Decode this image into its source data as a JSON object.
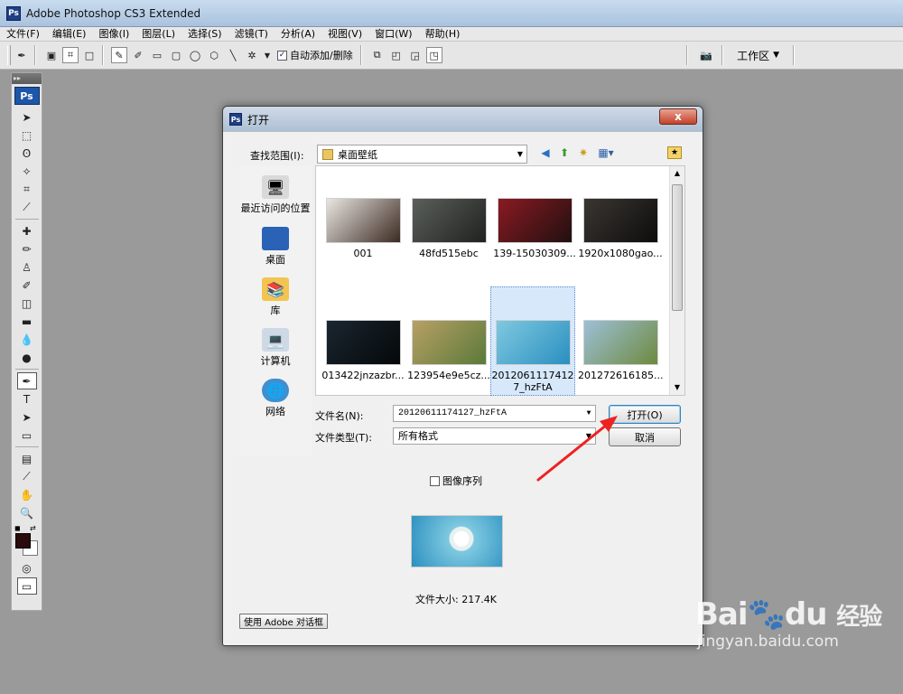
{
  "app": {
    "title": "Adobe Photoshop CS3 Extended",
    "logo_text": "Ps"
  },
  "menu": [
    "文件(F)",
    "编辑(E)",
    "图像(I)",
    "图层(L)",
    "选择(S)",
    "滤镜(T)",
    "分析(A)",
    "视图(V)",
    "窗口(W)",
    "帮助(H)"
  ],
  "options_bar": {
    "auto_add_delete_label": "自动添加/删除",
    "auto_add_delete_checked": true,
    "workspace_label": "工作区",
    "icons": [
      "pen-icon",
      "shape-layers-icon",
      "paths-icon",
      "fill-pixels-icon",
      "pen-tool-icon",
      "freeform-pen-icon",
      "rectangle-icon",
      "rounded-rectangle-icon",
      "ellipse-icon",
      "polygon-icon",
      "line-icon",
      "custom-shape-icon"
    ]
  },
  "tools_panel": {
    "logo_text": "Ps",
    "colors": {
      "foreground": "#2a0a0a",
      "background": "#ffffff"
    }
  },
  "dialog": {
    "title": "打开",
    "close_glyph": "x",
    "look_in_label": "查找范围(I):",
    "look_in_value": "桌面壁纸",
    "places": [
      {
        "label": "最近访问的位置",
        "icon": "recent-places-icon"
      },
      {
        "label": "桌面",
        "icon": "desktop-icon"
      },
      {
        "label": "库",
        "icon": "libraries-icon"
      },
      {
        "label": "计算机",
        "icon": "computer-icon"
      },
      {
        "label": "网络",
        "icon": "network-icon"
      }
    ],
    "files": [
      {
        "name": "001",
        "colors": [
          "#e9e6e1",
          "#3b2a22"
        ]
      },
      {
        "name": "48fd515ebc",
        "colors": [
          "#5b5f5a",
          "#1f2220"
        ]
      },
      {
        "name": "139-15030309...",
        "colors": [
          "#8a1a22",
          "#201010"
        ]
      },
      {
        "name": "1920x1080gao...",
        "colors": [
          "#3a3632",
          "#0e0d0c"
        ]
      },
      {
        "name": "013422jnzazbr...",
        "colors": [
          "#1a2630",
          "#050809"
        ]
      },
      {
        "name": "123954e9e5cz...",
        "colors": [
          "#b8a064",
          "#5a7a3a"
        ]
      },
      {
        "name": "20120611174127_hzFtA",
        "colors": [
          "#7ec9e0",
          "#2b8fc0"
        ],
        "selected": true
      },
      {
        "name": "201272616185...",
        "colors": [
          "#9cc0d8",
          "#6e8a3e"
        ]
      }
    ],
    "file_name_label": "文件名(N):",
    "file_name_value": "20120611174127_hzFtA",
    "file_type_label": "文件类型(T):",
    "file_type_value": "所有格式",
    "open_button": "打开(O)",
    "cancel_button": "取消",
    "image_sequence_label": "图像序列",
    "image_sequence_checked": false,
    "file_size": "文件大小: 217.4K",
    "adobe_dialog_button": "使用 Adobe 对话框"
  },
  "watermark": {
    "logo": "Bai du 经验",
    "logo_left": "Bai",
    "logo_mid": "du",
    "logo_right": "经验",
    "url": "jingyan.baidu.com"
  }
}
